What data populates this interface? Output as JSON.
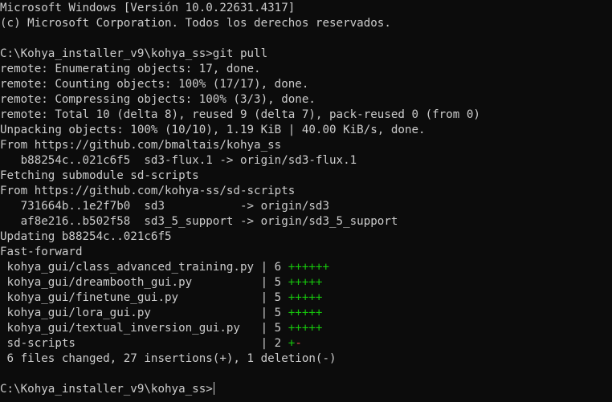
{
  "terminal": {
    "header": [
      "Microsoft Windows [Versión 10.0.22631.4317]",
      "(c) Microsoft Corporation. Todos los derechos reservados."
    ],
    "command": {
      "prompt": "C:\\Kohya_installer_v9\\kohya_ss>",
      "text": "git pull"
    },
    "output": [
      "remote: Enumerating objects: 17, done.",
      "remote: Counting objects: 100% (17/17), done.",
      "remote: Compressing objects: 100% (3/3), done.",
      "remote: Total 10 (delta 8), reused 9 (delta 7), pack-reused 0 (from 0)",
      "Unpacking objects: 100% (10/10), 1.19 KiB | 40.00 KiB/s, done.",
      "From https://github.com/bmaltais/kohya_ss",
      "   b88254c..021c6f5  sd3-flux.1 -> origin/sd3-flux.1",
      "Fetching submodule sd-scripts",
      "From https://github.com/kohya-ss/sd-scripts",
      "   731664b..1e2f7b0  sd3           -> origin/sd3",
      "   af8e216..b502f58  sd3_5_support -> origin/sd3_5_support",
      "Updating b88254c..021c6f5",
      "Fast-forward"
    ],
    "diffstat": [
      {
        "path": " kohya_gui/class_advanced_training.py | ",
        "count": "6 ",
        "plus": "++++++",
        "minus": ""
      },
      {
        "path": " kohya_gui/dreambooth_gui.py          | ",
        "count": "5 ",
        "plus": "+++++",
        "minus": ""
      },
      {
        "path": " kohya_gui/finetune_gui.py            | ",
        "count": "5 ",
        "plus": "+++++",
        "minus": ""
      },
      {
        "path": " kohya_gui/lora_gui.py                | ",
        "count": "5 ",
        "plus": "+++++",
        "minus": ""
      },
      {
        "path": " kohya_gui/textual_inversion_gui.py   | ",
        "count": "5 ",
        "plus": "+++++",
        "minus": ""
      },
      {
        "path": " sd-scripts                           | ",
        "count": "2 ",
        "plus": "+",
        "minus": "-"
      }
    ],
    "summary": " 6 files changed, 27 insertions(+), 1 deletion(-)",
    "final_prompt": "C:\\Kohya_installer_v9\\kohya_ss>"
  },
  "colors": {
    "background": "#0c0c0c",
    "foreground": "#cccccc",
    "plus": "#16c60c",
    "minus": "#e74856"
  }
}
